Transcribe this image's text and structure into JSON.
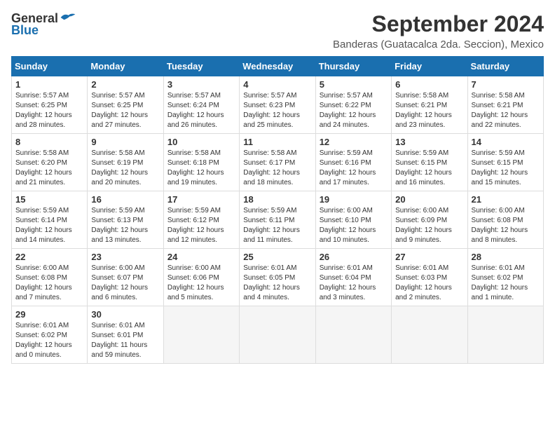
{
  "header": {
    "logo_general": "General",
    "logo_blue": "Blue",
    "main_title": "September 2024",
    "subtitle": "Banderas (Guatacalca 2da. Seccion), Mexico"
  },
  "calendar": {
    "headers": [
      "Sunday",
      "Monday",
      "Tuesday",
      "Wednesday",
      "Thursday",
      "Friday",
      "Saturday"
    ],
    "weeks": [
      [
        {
          "num": "",
          "info": ""
        },
        {
          "num": "2",
          "info": "Sunrise: 5:57 AM\nSunset: 6:25 PM\nDaylight: 12 hours\nand 27 minutes."
        },
        {
          "num": "3",
          "info": "Sunrise: 5:57 AM\nSunset: 6:24 PM\nDaylight: 12 hours\nand 26 minutes."
        },
        {
          "num": "4",
          "info": "Sunrise: 5:57 AM\nSunset: 6:23 PM\nDaylight: 12 hours\nand 25 minutes."
        },
        {
          "num": "5",
          "info": "Sunrise: 5:57 AM\nSunset: 6:22 PM\nDaylight: 12 hours\nand 24 minutes."
        },
        {
          "num": "6",
          "info": "Sunrise: 5:58 AM\nSunset: 6:21 PM\nDaylight: 12 hours\nand 23 minutes."
        },
        {
          "num": "7",
          "info": "Sunrise: 5:58 AM\nSunset: 6:21 PM\nDaylight: 12 hours\nand 22 minutes."
        }
      ],
      [
        {
          "num": "8",
          "info": "Sunrise: 5:58 AM\nSunset: 6:20 PM\nDaylight: 12 hours\nand 21 minutes."
        },
        {
          "num": "9",
          "info": "Sunrise: 5:58 AM\nSunset: 6:19 PM\nDaylight: 12 hours\nand 20 minutes."
        },
        {
          "num": "10",
          "info": "Sunrise: 5:58 AM\nSunset: 6:18 PM\nDaylight: 12 hours\nand 19 minutes."
        },
        {
          "num": "11",
          "info": "Sunrise: 5:58 AM\nSunset: 6:17 PM\nDaylight: 12 hours\nand 18 minutes."
        },
        {
          "num": "12",
          "info": "Sunrise: 5:59 AM\nSunset: 6:16 PM\nDaylight: 12 hours\nand 17 minutes."
        },
        {
          "num": "13",
          "info": "Sunrise: 5:59 AM\nSunset: 6:15 PM\nDaylight: 12 hours\nand 16 minutes."
        },
        {
          "num": "14",
          "info": "Sunrise: 5:59 AM\nSunset: 6:15 PM\nDaylight: 12 hours\nand 15 minutes."
        }
      ],
      [
        {
          "num": "15",
          "info": "Sunrise: 5:59 AM\nSunset: 6:14 PM\nDaylight: 12 hours\nand 14 minutes."
        },
        {
          "num": "16",
          "info": "Sunrise: 5:59 AM\nSunset: 6:13 PM\nDaylight: 12 hours\nand 13 minutes."
        },
        {
          "num": "17",
          "info": "Sunrise: 5:59 AM\nSunset: 6:12 PM\nDaylight: 12 hours\nand 12 minutes."
        },
        {
          "num": "18",
          "info": "Sunrise: 5:59 AM\nSunset: 6:11 PM\nDaylight: 12 hours\nand 11 minutes."
        },
        {
          "num": "19",
          "info": "Sunrise: 6:00 AM\nSunset: 6:10 PM\nDaylight: 12 hours\nand 10 minutes."
        },
        {
          "num": "20",
          "info": "Sunrise: 6:00 AM\nSunset: 6:09 PM\nDaylight: 12 hours\nand 9 minutes."
        },
        {
          "num": "21",
          "info": "Sunrise: 6:00 AM\nSunset: 6:08 PM\nDaylight: 12 hours\nand 8 minutes."
        }
      ],
      [
        {
          "num": "22",
          "info": "Sunrise: 6:00 AM\nSunset: 6:08 PM\nDaylight: 12 hours\nand 7 minutes."
        },
        {
          "num": "23",
          "info": "Sunrise: 6:00 AM\nSunset: 6:07 PM\nDaylight: 12 hours\nand 6 minutes."
        },
        {
          "num": "24",
          "info": "Sunrise: 6:00 AM\nSunset: 6:06 PM\nDaylight: 12 hours\nand 5 minutes."
        },
        {
          "num": "25",
          "info": "Sunrise: 6:01 AM\nSunset: 6:05 PM\nDaylight: 12 hours\nand 4 minutes."
        },
        {
          "num": "26",
          "info": "Sunrise: 6:01 AM\nSunset: 6:04 PM\nDaylight: 12 hours\nand 3 minutes."
        },
        {
          "num": "27",
          "info": "Sunrise: 6:01 AM\nSunset: 6:03 PM\nDaylight: 12 hours\nand 2 minutes."
        },
        {
          "num": "28",
          "info": "Sunrise: 6:01 AM\nSunset: 6:02 PM\nDaylight: 12 hours\nand 1 minute."
        }
      ],
      [
        {
          "num": "29",
          "info": "Sunrise: 6:01 AM\nSunset: 6:02 PM\nDaylight: 12 hours\nand 0 minutes."
        },
        {
          "num": "30",
          "info": "Sunrise: 6:01 AM\nSunset: 6:01 PM\nDaylight: 11 hours\nand 59 minutes."
        },
        {
          "num": "",
          "info": ""
        },
        {
          "num": "",
          "info": ""
        },
        {
          "num": "",
          "info": ""
        },
        {
          "num": "",
          "info": ""
        },
        {
          "num": "",
          "info": ""
        }
      ]
    ],
    "week0_day1": {
      "num": "1",
      "info": "Sunrise: 5:57 AM\nSunset: 6:25 PM\nDaylight: 12 hours\nand 28 minutes."
    }
  }
}
